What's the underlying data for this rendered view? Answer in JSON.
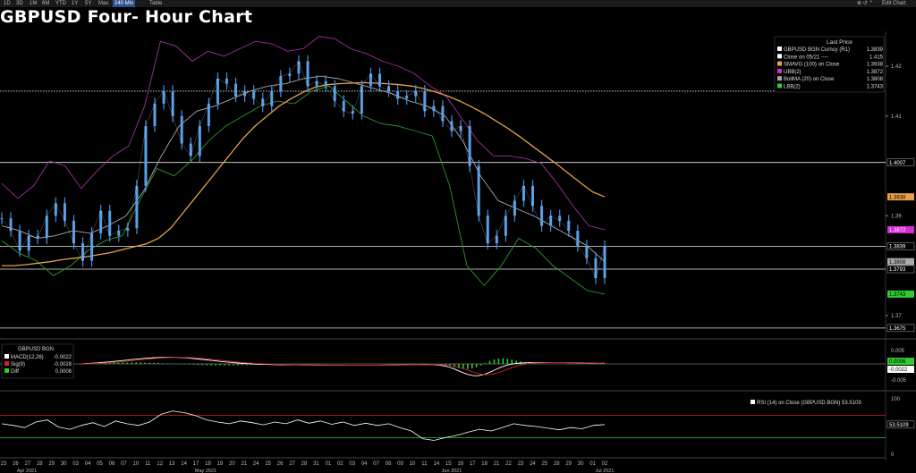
{
  "toolbar": {
    "items": [
      "1D",
      "3D",
      "1M",
      "6M",
      "YTD",
      "1Y",
      "5Y",
      "Max",
      "240 Min",
      "Table"
    ],
    "active": "240 Min",
    "right_icons": "⊕ ↺ ⌃",
    "edit_chart": "Edit Chart"
  },
  "title": "GBPUSD Four- Hour Chart",
  "legend": {
    "header": "Last Price",
    "rows": [
      {
        "color": "#ffffff",
        "label": "GBPUSD BGN Curncy  (R1)",
        "value": "1.3839"
      },
      {
        "color": "#ffffff",
        "label": "Close on 05/21 ----",
        "value": "1.415"
      },
      {
        "color": "#e8a044",
        "label": "SMAVG (100)  on Close",
        "value": "1.3938"
      },
      {
        "color": "#d62ad6",
        "label": "UBB(2)",
        "value": "1.3872"
      },
      {
        "color": "#aaaaaa",
        "label": "BollMA (20)  on Close",
        "value": "1.3808"
      },
      {
        "color": "#2ecc2e",
        "label": "LBB(2)",
        "value": "1.3743"
      }
    ]
  },
  "chart_data": {
    "type": "line",
    "ylim": [
      1.3655,
      1.427
    ],
    "ytick_labels": [
      "1.42",
      "1.41",
      "1.39",
      "1.37"
    ],
    "price_tags": [
      {
        "label": "1.4007",
        "bg": "#000000",
        "fg": "#ffffff"
      },
      {
        "label": "1.3938",
        "bg": "#e8a044",
        "fg": "#000000"
      },
      {
        "label": "1.3872",
        "bg": "#d62ad6",
        "fg": "#ffffff"
      },
      {
        "label": "1.3839",
        "bg": "#000000",
        "fg": "#ffffff"
      },
      {
        "label": "1.3808",
        "bg": "#aaaaaa",
        "fg": "#000000"
      },
      {
        "label": "1.3793",
        "bg": "#000000",
        "fg": "#ffffff"
      },
      {
        "label": "1.3743",
        "bg": "#2ecc2e",
        "fg": "#000000"
      },
      {
        "label": "1.3675",
        "bg": "#000000",
        "fg": "#ffffff"
      }
    ],
    "hlines": [
      1.415,
      1.4007,
      1.3839,
      1.3793,
      1.3675
    ],
    "series": [
      {
        "name": "GBPUSD BGN Curncy",
        "values": [
          1.3895,
          1.387,
          1.383,
          1.386,
          1.3855,
          1.39,
          1.3925,
          1.389,
          1.3845,
          1.381,
          1.3865,
          1.391,
          1.386,
          1.387,
          1.3875,
          1.396,
          1.408,
          1.4125,
          1.415,
          1.41,
          1.4045,
          1.402,
          1.408,
          1.4125,
          1.4175,
          1.4165,
          1.414,
          1.415,
          1.4135,
          1.412,
          1.415,
          1.418,
          1.4185,
          1.421,
          1.416,
          1.417,
          1.416,
          1.413,
          1.411,
          1.4105,
          1.416,
          1.4185,
          1.416,
          1.415,
          1.4135,
          1.414,
          1.415,
          1.411,
          1.412,
          1.409,
          1.407,
          1.408,
          1.4,
          1.39,
          1.3845,
          1.386,
          1.39,
          1.393,
          1.396,
          1.392,
          1.388,
          1.39,
          1.389,
          1.387,
          1.384,
          1.3815,
          1.3775,
          1.3839
        ]
      },
      {
        "name": "SMAVG (100)",
        "values": [
          1.38,
          1.38,
          1.3802,
          1.3805,
          1.3808,
          1.3812,
          1.3815,
          1.3818,
          1.3822,
          1.3826,
          1.3832,
          1.3838,
          1.3844,
          1.3855,
          1.3875,
          1.3905,
          1.3935,
          1.3965,
          1.3995,
          1.4025,
          1.4055,
          1.408,
          1.41,
          1.412,
          1.4135,
          1.4148,
          1.4158,
          1.4163,
          1.4165,
          1.4166,
          1.4167,
          1.4166,
          1.4165,
          1.4163,
          1.416,
          1.4155,
          1.4148,
          1.414,
          1.413,
          1.4118,
          1.4105,
          1.409,
          1.4075,
          1.4058,
          1.404,
          1.4022,
          1.4004,
          1.3985,
          1.3966,
          1.3948,
          1.3938
        ]
      },
      {
        "name": "UBB(2)",
        "values": [
          1.3965,
          1.3935,
          1.396,
          1.401,
          1.4,
          1.3955,
          1.399,
          1.402,
          1.404,
          1.412,
          1.425,
          1.424,
          1.421,
          1.423,
          1.422,
          1.4235,
          1.425,
          1.4245,
          1.423,
          1.4235,
          1.426,
          1.4255,
          1.4235,
          1.4225,
          1.421,
          1.42,
          1.4185,
          1.416,
          1.414,
          1.4095,
          1.405,
          1.402,
          1.402,
          1.4015,
          1.4005,
          1.3965,
          1.392,
          1.388,
          1.3872
        ]
      },
      {
        "name": "BollMA (20)",
        "values": [
          1.388,
          1.387,
          1.3855,
          1.386,
          1.387,
          1.3865,
          1.388,
          1.39,
          1.395,
          1.402,
          1.408,
          1.411,
          1.412,
          1.4135,
          1.415,
          1.416,
          1.4165,
          1.4175,
          1.418,
          1.4175,
          1.4165,
          1.4155,
          1.4145,
          1.413,
          1.412,
          1.41,
          1.405,
          1.398,
          1.393,
          1.3915,
          1.39,
          1.388,
          1.386,
          1.384,
          1.3808
        ]
      },
      {
        "name": "LBB(2)",
        "values": [
          1.385,
          1.3825,
          1.381,
          1.378,
          1.38,
          1.383,
          1.385,
          1.386,
          1.393,
          1.3995,
          1.398,
          1.401,
          1.405,
          1.408,
          1.41,
          1.412,
          1.413,
          1.4125,
          1.415,
          1.416,
          1.413,
          1.41,
          1.4085,
          1.408,
          1.407,
          1.406,
          1.396,
          1.38,
          1.376,
          1.38,
          1.3855,
          1.3835,
          1.38,
          1.3775,
          1.375,
          1.3743
        ]
      }
    ],
    "macd": {
      "legend_title": "GBPUSD BGN",
      "rows": [
        {
          "color": "#ffffff",
          "label": "MACD(12,26)",
          "value": "-0.0022"
        },
        {
          "color": "#d62020",
          "label": "Sig(9)",
          "value": "-0.0028"
        },
        {
          "color": "#2ecc2e",
          "label": "Diff",
          "value": "0.0006"
        }
      ],
      "ytick_labels": [
        "0.005",
        "-0.005"
      ],
      "tags": [
        {
          "label": "0.0006",
          "bg": "#2ecc2e",
          "fg": "#000000"
        },
        {
          "label": "-0.0022",
          "bg": "#ffffff",
          "fg": "#000000"
        }
      ]
    },
    "rsi": {
      "legend": "RSI (14)  on Close (GBPUSD BGN)",
      "value": "53.5109",
      "ytick_labels": [
        "100",
        "50",
        "0"
      ],
      "tag": "53.5109",
      "overbought": 70,
      "oversold": 30,
      "values": [
        55,
        52,
        48,
        58,
        62,
        49,
        45,
        52,
        57,
        50,
        60,
        55,
        52,
        58,
        72,
        78,
        75,
        70,
        62,
        58,
        55,
        60,
        57,
        53,
        58,
        55,
        62,
        56,
        60,
        54,
        58,
        52,
        56,
        52,
        55,
        48,
        42,
        28,
        25,
        30,
        34,
        40,
        45,
        42,
        48,
        55,
        52,
        50,
        47,
        44,
        48,
        46,
        52,
        53.5
      ]
    },
    "x_tick_labels": [
      "23",
      "26",
      "27",
      "28",
      "29",
      "30",
      "03",
      "04",
      "05",
      "06",
      "07",
      "10",
      "11",
      "12",
      "13",
      "14",
      "17",
      "18",
      "19",
      "20",
      "21",
      "24",
      "25",
      "26",
      "27",
      "28",
      "31",
      "01",
      "02",
      "03",
      "04",
      "07",
      "08",
      "09",
      "10",
      "11",
      "14",
      "15",
      "16",
      "17",
      "18",
      "21",
      "22",
      "23",
      "24",
      "25",
      "28",
      "29",
      "30",
      "01",
      "02"
    ],
    "x_month_labels": [
      "Apr 2021",
      "May 2021",
      "Jun 2021",
      "Jul 2021"
    ]
  }
}
